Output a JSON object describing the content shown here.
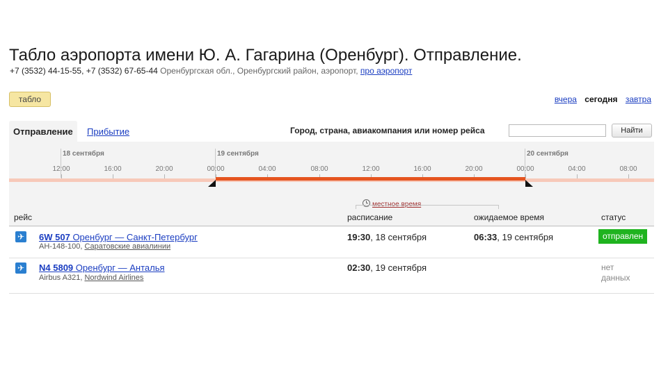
{
  "page_title": "Табло аэропорта имени Ю. А. Гагарина (Оренбург). Отправление.",
  "contacts": {
    "phones": "+7 (3532) 44-15-55, +7 (3532) 67-65-44",
    "address": "Оренбургская обл., Оренбургский район, аэропорт,",
    "about_link": "про аэропорт"
  },
  "tablo_button": "табло",
  "day_switch": {
    "yesterday": "вчера",
    "today": "сегодня",
    "tomorrow": "завтра"
  },
  "tabs": {
    "departure": "Отправление",
    "arrival": "Прибытие"
  },
  "search": {
    "label": "Город, страна, авиакомпания или номер рейса",
    "value": "",
    "button": "Найти"
  },
  "timeline": {
    "dates": [
      "18 сентября",
      "19 сентября",
      "20 сентября"
    ],
    "ticks": [
      "12:00",
      "16:00",
      "20:00",
      "00:00",
      "04:00",
      "08:00",
      "12:00",
      "16:00",
      "20:00",
      "00:00",
      "04:00",
      "08:00"
    ],
    "selected_range": [
      "00:00",
      "00:00"
    ]
  },
  "table": {
    "col_flight": "рейс",
    "local_time": "местное время",
    "col_schedule": "расписание",
    "col_expected": "ожидаемое время",
    "col_status": "статус",
    "rows": [
      {
        "flight_no": "6W 507",
        "route": "Оренбург — Санкт-Петербург",
        "aircraft": "АН-148-100,",
        "airline": "Саратовские авиалинии",
        "sched_time": "19:30",
        "sched_date": ", 18 сентября",
        "exp_time": "06:33",
        "exp_date": ", 19 сентября",
        "status": "отправлен"
      },
      {
        "flight_no": "N4 5809",
        "route": "Оренбург — Анталья",
        "aircraft": "Airbus A321,",
        "airline": "Nordwind Airlines",
        "sched_time": "02:30",
        "sched_date": ", 19 сентября",
        "exp_time": "",
        "exp_date": "",
        "status_line1": "нет",
        "status_line2": "данных"
      }
    ]
  },
  "colors": {
    "accent": "#e5541f",
    "link": "#1a3dc1",
    "status_ok": "#1fb31f"
  }
}
